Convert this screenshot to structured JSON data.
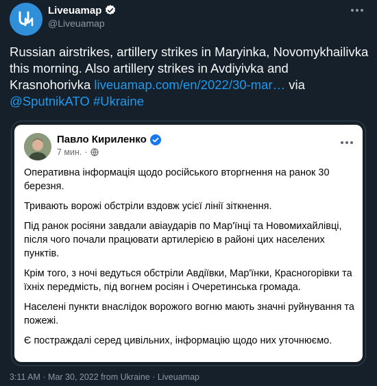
{
  "tweet": {
    "display_name": "Liveuamap",
    "handle": "@Liveuamap",
    "text_parts": {
      "main": "Russian airstrikes, artillery strikes in Maryinka, Novomykhailivka this morning. Also artillery strikes in Avdiyivka and Krasnohorivka ",
      "link": "liveuamap.com/en/2022/30-mar…",
      "via": " via ",
      "mention": "@SputnikATO",
      "space": " ",
      "hashtag": "#Ukraine"
    },
    "footer": "3:11 AM · Mar 30, 2022 from Ukraine · Liveuamap"
  },
  "quoted_post": {
    "author": "Павло Кириленко",
    "time": "7 мин.",
    "dot": "·",
    "paragraphs": [
      "Оперативна інформація щодо російського вторгнення на ранок 30 березня.",
      "Тривають ворожі обстріли вздовж усієї лінії зіткнення.",
      "Під ранок росіяни завдали авіаударів по Мар'їнці та Новомихайлівці, після чого почали працювати артилерією в районі цих населених пунктів.",
      "Крім того, з ночі ведуться обстріли Авдіївки, Мар'їнки, Красногорівки та їхніх передмість, під вогнем росіян і Очеретинська громада.",
      "Населені пункти внаслідок ворожого вогню мають значні руйнування та пожежі.",
      "Є постраждалі серед цивільних, інформацію щодо них уточнюємо."
    ]
  },
  "colors": {
    "background": "#15202b",
    "link": "#1d9bf0",
    "secondary_text": "#8b98a5"
  },
  "icons": {
    "avatar": "liveuamap-logo-icon",
    "verified": "verified-badge-icon",
    "more": "more-dots-icon",
    "privacy": "globe-icon"
  }
}
